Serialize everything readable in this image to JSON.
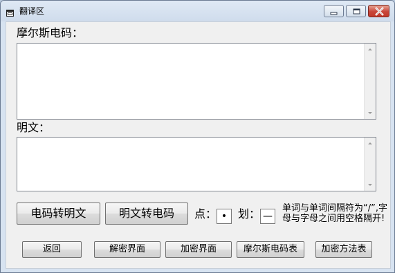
{
  "window": {
    "title": "翻译区"
  },
  "morse": {
    "label": "摩尔斯电码：",
    "value": ""
  },
  "plain": {
    "label": "明文：",
    "value": ""
  },
  "buttons": {
    "morse_to_plain": "电码转明文",
    "plain_to_morse": "明文转电码",
    "back": "返回",
    "decrypt_ui": "解密界面",
    "encrypt_ui": "加密界面",
    "morse_table": "摩尔斯电码表",
    "encrypt_method_table": "加密方法表"
  },
  "symbols": {
    "dot_label": "点：",
    "dot_value": "•",
    "dash_label": "划：",
    "dash_value": "—"
  },
  "hint": "单词与单词间隔符为“/”,字母与字母之间用空格隔开!",
  "icons": {
    "app": "window-app-icon",
    "minimize": "minimize-icon",
    "maximize": "maximize-icon",
    "close": "close-icon"
  }
}
